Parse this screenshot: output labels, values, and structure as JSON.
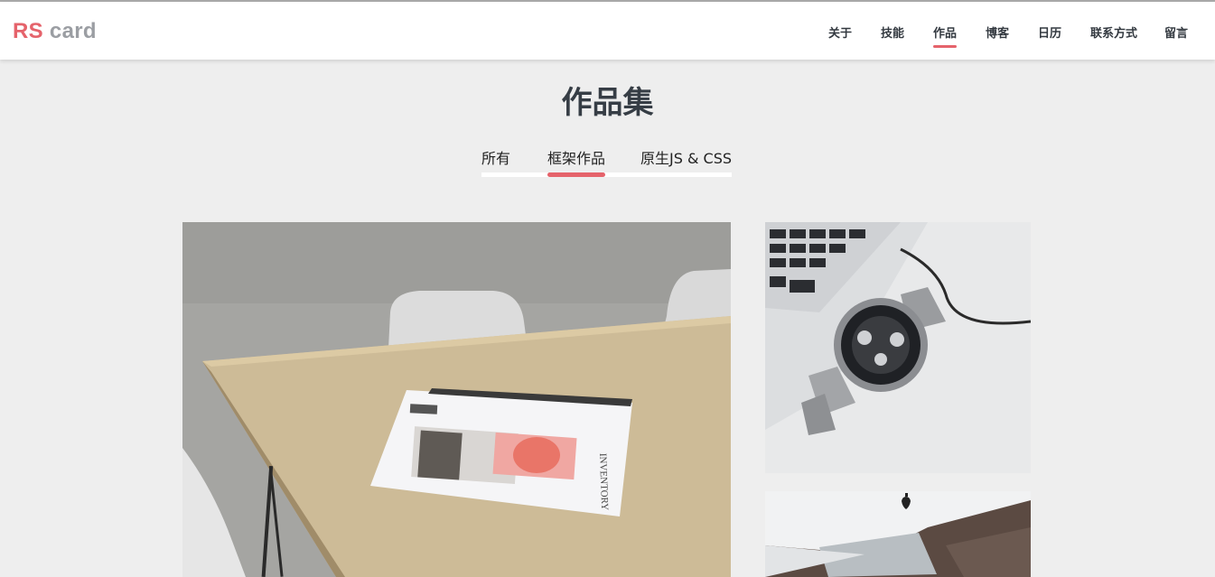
{
  "brand": {
    "rs": "RS",
    "card": "card",
    "accent": "#e5636b",
    "gray": "#9b9ea3"
  },
  "nav": {
    "items": [
      {
        "label": "关于"
      },
      {
        "label": "技能"
      },
      {
        "label": "作品",
        "active": true
      },
      {
        "label": "博客"
      },
      {
        "label": "日历"
      },
      {
        "label": "联系方式"
      },
      {
        "label": "留言"
      }
    ]
  },
  "section": {
    "title": "作品集",
    "filters": [
      {
        "label": "所有"
      },
      {
        "label": "框架作品",
        "active": true
      },
      {
        "label": "原生JS & CSS"
      }
    ]
  },
  "portfolio": {
    "items": [
      {
        "image": "magazine-on-table-photo"
      },
      {
        "image": "wristwatch-on-laptop-photo"
      },
      {
        "image": "imac-on-desk-photo"
      }
    ]
  },
  "colors": {
    "background": "#eeeeee",
    "header": "#ffffff",
    "text": "#363d45"
  }
}
